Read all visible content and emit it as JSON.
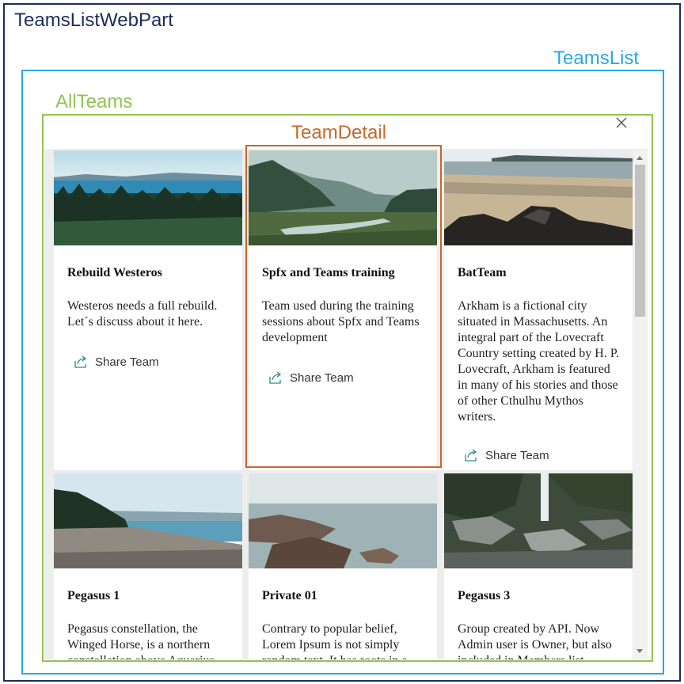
{
  "labels": {
    "webpart": "TeamsListWebPart",
    "teamslist": "TeamsList",
    "allteams": "AllTeams",
    "teamdetail": "TeamDetail"
  },
  "colors": {
    "webpart": "#1b2b5c",
    "teamslist": "#29a8e0",
    "allteams": "#92c353",
    "teamdetail": "#c5692b",
    "share_icon": "#2a8a8a"
  },
  "share_label": "Share Team",
  "teams": [
    {
      "title": "Rebuild Westeros",
      "description": "Westeros needs a full rebuild. Let´s discuss about it here.",
      "image": "lake-forest"
    },
    {
      "title": "Spfx and Teams training",
      "description": "Team used during the training sessions about Spfx and Teams development",
      "image": "misty-river"
    },
    {
      "title": "BatTeam",
      "description": "Arkham is a fictional city situated in Massachusetts. An integral part of the Lovecraft Country setting created by H. P. Lovecraft, Arkham is featured in many of his stories and those of other Cthulhu Mythos writers.",
      "image": "rocky-beach"
    },
    {
      "title": "Pegasus 1",
      "description": "Pegasus constellation, the Winged Horse, is a northern constellation above Aquarius",
      "image": "pebble-shore"
    },
    {
      "title": "Private 01",
      "description": "Contrary to popular belief, Lorem Ipsum is not simply random text. It has roots in a",
      "image": "sea-rocks"
    },
    {
      "title": "Pegasus 3",
      "description": "Group created by API. Now Admin user is Owner, but also included in Members list",
      "image": "waterfall-rocks"
    }
  ]
}
